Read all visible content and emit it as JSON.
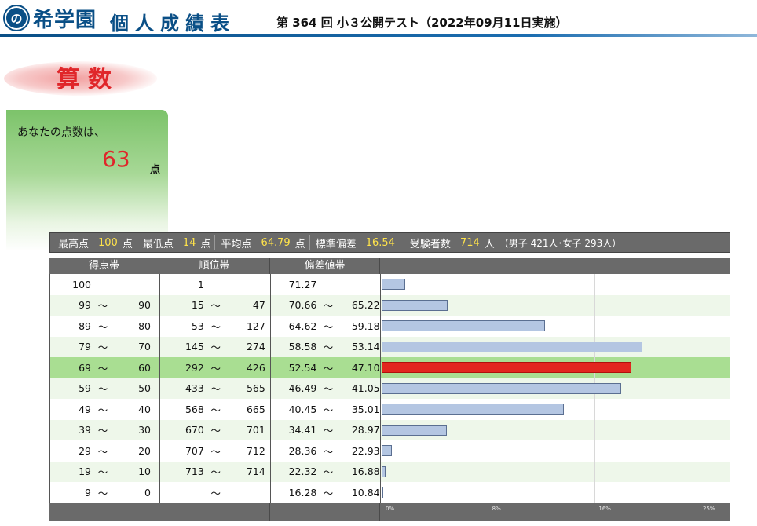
{
  "header": {
    "logo_mark": "の",
    "logo_name": "希学園",
    "report_title": "個人成績表",
    "exam_title": "第 364 回 小３公開テスト（2022年09月11日実施）"
  },
  "subject": "算数",
  "score": {
    "lead": "あなたの点数は、",
    "value": "63",
    "unit": "点"
  },
  "stats": {
    "max_label": "最高点",
    "max_value": "100",
    "max_unit": "点",
    "min_label": "最低点",
    "min_value": "14",
    "min_unit": "点",
    "avg_label": "平均点",
    "avg_value": "64.79",
    "avg_unit": "点",
    "sd_label": "標準偏差",
    "sd_value": "16.54",
    "count_label": "受験者数",
    "count_value": "714",
    "count_unit": "人",
    "gender_note": "（男子 421人･女子 293人）"
  },
  "table": {
    "headers": [
      "得点帯",
      "順位帯",
      "偏差値帯",
      ""
    ],
    "ticks": [
      "0%",
      "8%",
      "16%",
      "25%"
    ],
    "tilde": "～",
    "rows": [
      {
        "score_from": "100",
        "score_to": "",
        "rank_from": "1",
        "rank_to": "",
        "dev_from": "71.27",
        "dev_to": "",
        "pct": 1.8,
        "me": false,
        "single": true
      },
      {
        "score_from": "99",
        "score_to": "90",
        "rank_from": "15",
        "rank_to": "47",
        "dev_from": "70.66",
        "dev_to": "65.22",
        "pct": 5.0,
        "me": false
      },
      {
        "score_from": "89",
        "score_to": "80",
        "rank_from": "53",
        "rank_to": "127",
        "dev_from": "64.62",
        "dev_to": "59.18",
        "pct": 12.3,
        "me": false
      },
      {
        "score_from": "79",
        "score_to": "70",
        "rank_from": "145",
        "rank_to": "274",
        "dev_from": "58.58",
        "dev_to": "53.14",
        "pct": 19.6,
        "me": false
      },
      {
        "score_from": "69",
        "score_to": "60",
        "rank_from": "292",
        "rank_to": "426",
        "dev_from": "52.54",
        "dev_to": "47.10",
        "pct": 18.8,
        "me": true
      },
      {
        "score_from": "59",
        "score_to": "50",
        "rank_from": "433",
        "rank_to": "565",
        "dev_from": "46.49",
        "dev_to": "41.05",
        "pct": 18.0,
        "me": false
      },
      {
        "score_from": "49",
        "score_to": "40",
        "rank_from": "568",
        "rank_to": "665",
        "dev_from": "40.45",
        "dev_to": "35.01",
        "pct": 13.7,
        "me": false
      },
      {
        "score_from": "39",
        "score_to": "30",
        "rank_from": "670",
        "rank_to": "701",
        "dev_from": "34.41",
        "dev_to": "28.97",
        "pct": 4.9,
        "me": false
      },
      {
        "score_from": "29",
        "score_to": "20",
        "rank_from": "707",
        "rank_to": "712",
        "dev_from": "28.36",
        "dev_to": "22.93",
        "pct": 0.8,
        "me": false
      },
      {
        "score_from": "19",
        "score_to": "10",
        "rank_from": "713",
        "rank_to": "714",
        "dev_from": "22.32",
        "dev_to": "16.88",
        "pct": 0.3,
        "me": false
      },
      {
        "score_from": "9",
        "score_to": "0",
        "rank_from": "",
        "rank_to": "",
        "dev_from": "16.28",
        "dev_to": "10.84",
        "pct": 0.1,
        "me": false,
        "rank_tilde_only": true
      }
    ]
  },
  "chart_data": {
    "type": "bar",
    "orientation": "horizontal",
    "categories": [
      "100",
      "99～90",
      "89～80",
      "79～70",
      "69～60",
      "59～50",
      "49～40",
      "39～30",
      "29～20",
      "19～10",
      "9～0"
    ],
    "values": [
      1.8,
      5.0,
      12.3,
      19.6,
      18.8,
      18.0,
      13.7,
      4.9,
      0.8,
      0.3,
      0.1
    ],
    "xlim": [
      0,
      25
    ],
    "tick_labels": [
      "0%",
      "8%",
      "16%",
      "25%"
    ],
    "highlight_category": "69～60"
  },
  "colors": {
    "brand": "#0a4f86",
    "accent": "#e0262a",
    "bar": "#b4c6e2",
    "bar_highlight": "#e2261f",
    "row_highlight": "#a9de92",
    "stat_value": "#ffe34a"
  }
}
